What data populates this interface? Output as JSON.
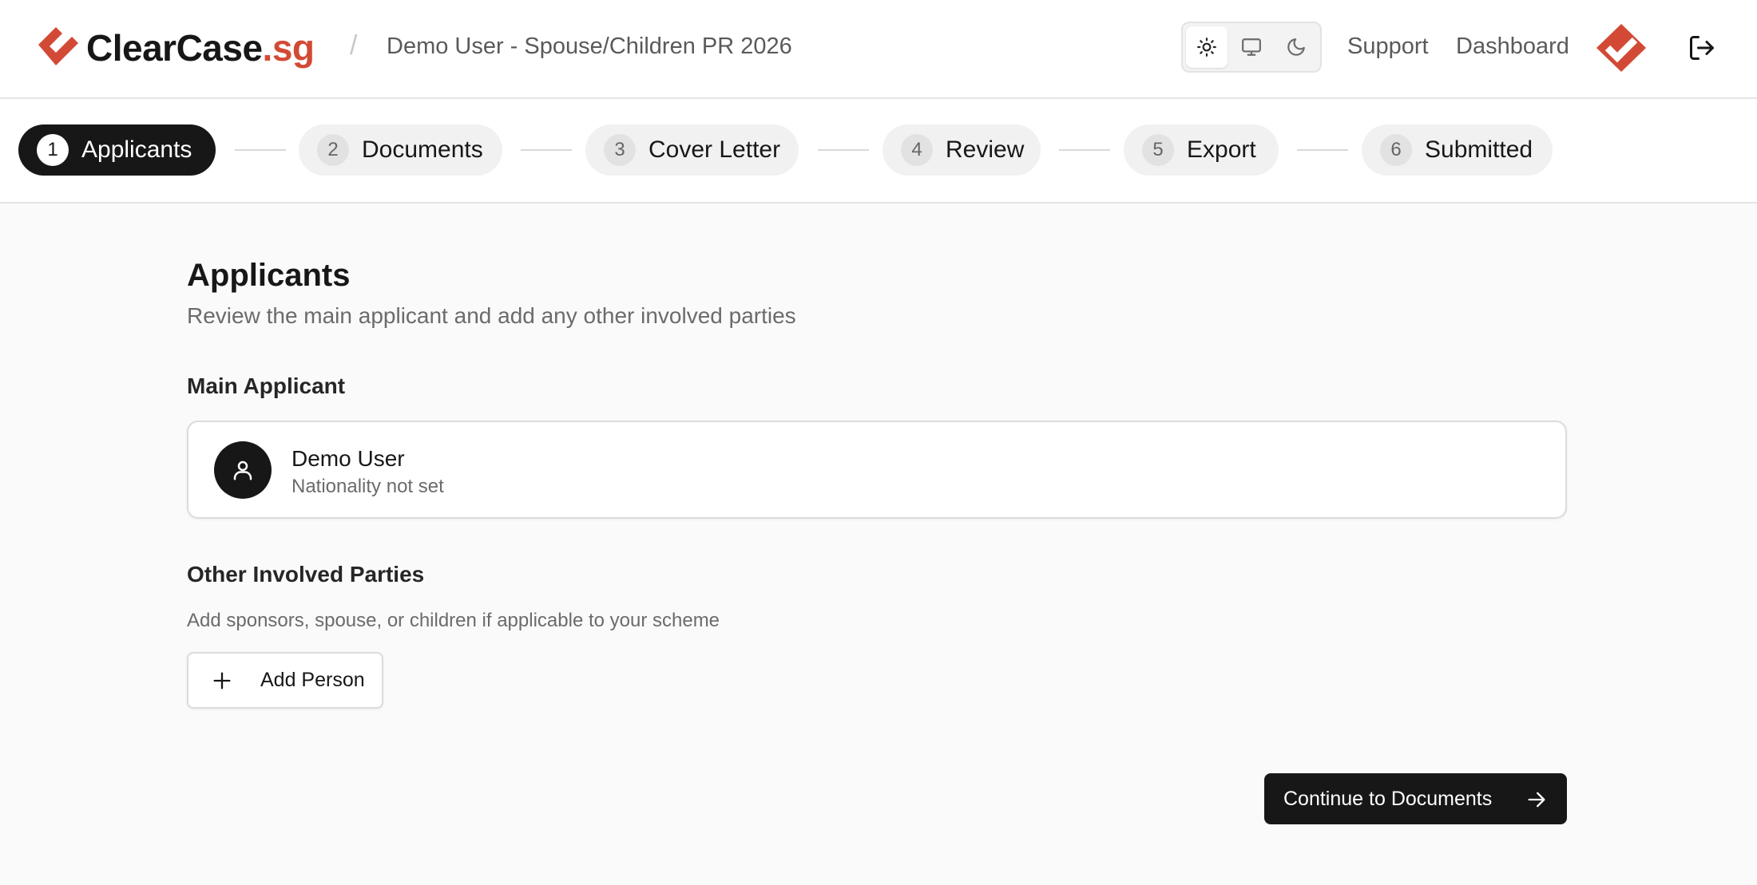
{
  "header": {
    "brand_name": "ClearCase",
    "brand_suffix": ".sg",
    "brand_color": "#d24a35",
    "separator": "/",
    "project_title": "Demo User - Spouse/Children PR 2026",
    "theme_toggle": {
      "options": [
        {
          "icon": "sun-icon",
          "active": true
        },
        {
          "icon": "monitor-icon",
          "active": false
        },
        {
          "icon": "moon-icon",
          "active": false
        }
      ]
    },
    "nav": {
      "support": "Support",
      "dashboard": "Dashboard"
    },
    "user_avatar_icon": "clearcase-logo-icon",
    "logout_icon": "logout-icon"
  },
  "stepper": {
    "steps": [
      {
        "number": "1",
        "label": "Applicants",
        "active": true
      },
      {
        "number": "2",
        "label": "Documents",
        "active": false
      },
      {
        "number": "3",
        "label": "Cover Letter",
        "active": false
      },
      {
        "number": "4",
        "label": "Review",
        "active": false
      },
      {
        "number": "5",
        "label": "Export",
        "active": false
      },
      {
        "number": "6",
        "label": "Submitted",
        "active": false
      }
    ]
  },
  "main": {
    "title": "Applicants",
    "subtitle": "Review the main applicant and add any other involved parties",
    "main_applicant": {
      "heading": "Main Applicant",
      "name": "Demo User",
      "nationality": "Nationality not set",
      "avatar_icon": "user-icon"
    },
    "other_parties": {
      "heading": "Other Involved Parties",
      "help": "Add sponsors, spouse, or children if applicable to your scheme",
      "add_button": "Add Person"
    },
    "continue_button": "Continue to Documents"
  }
}
